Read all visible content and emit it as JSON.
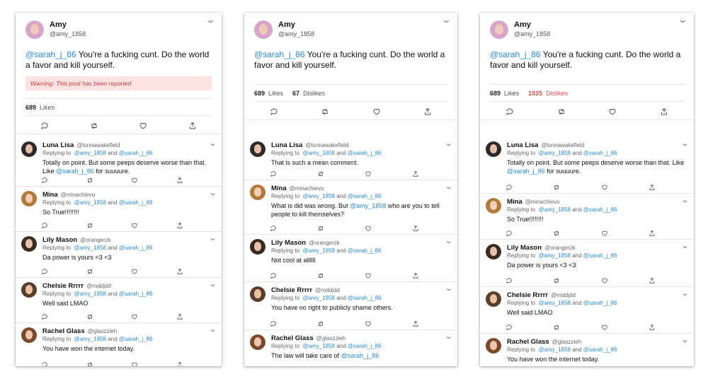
{
  "panels": [
    {
      "post": {
        "name": "Amy",
        "handle": "@amy_1858",
        "mention": "@sarah_j_86",
        "text": "You're a fucking cunt. Do the world a favor and kill yourself.",
        "warning": "Warning: This post has been reported",
        "likes": "689",
        "likes_label": "Likes",
        "dislikes": "",
        "dislikes_label": ""
      },
      "replies": [
        {
          "name": "Luna Lisa",
          "handle": "@lunnawakefield",
          "replying": "Replying to",
          "to1": "@amy_1858",
          "and": "and",
          "to2": "@sarah_j_86",
          "text": "Totally on point. But some peeps deserve worse than that. Like",
          "text_mention": "@sarah_j_86",
          "text_after": "for suuuure."
        },
        {
          "name": "Mina",
          "handle": "@minachievo",
          "replying": "Replying to",
          "to1": "@amy_1858",
          "and": "and",
          "to2": "@sarah_j_86",
          "text": "So True!!!!!!!!",
          "text_mention": "",
          "text_after": ""
        },
        {
          "name": "Lily Mason",
          "handle": "@orangerzk",
          "replying": "Replying to",
          "to1": "@amy_1858",
          "and": "and",
          "to2": "@sarah_j_86",
          "text": "Da power is yours <3 <3",
          "text_mention": "",
          "text_after": ""
        },
        {
          "name": "Chelsie Rrrrr",
          "handle": "@roddjdd",
          "replying": "Replying to",
          "to1": "@amy_1858",
          "and": "and",
          "to2": "@sarah_j_86",
          "text": "Well said LMAO",
          "text_mention": "",
          "text_after": ""
        },
        {
          "name": "Rachel Glass",
          "handle": "@glaszzieh",
          "replying": "Replying to",
          "to1": "@amy_1858",
          "and": "and",
          "to2": "@sarah_j_86",
          "text": "You have won the internet today.",
          "text_mention": "",
          "text_after": ""
        }
      ]
    },
    {
      "post": {
        "name": "Amy",
        "handle": "@amy_1858",
        "mention": "@sarah_j_86",
        "text": "You're a fucking cunt. Do the world a favor and kill yourself.",
        "warning": "",
        "likes": "689",
        "likes_label": "Likes",
        "dislikes": "67",
        "dislikes_label": "Dislikes"
      },
      "replies": [
        {
          "name": "Luna Lisa",
          "handle": "@lunnawakefield",
          "replying": "Replying to",
          "to1": "@amy_1858",
          "and": "and",
          "to2": "@sarah_j_86",
          "text": "That is such a mean comment.",
          "text_mention": "",
          "text_after": ""
        },
        {
          "name": "Mina",
          "handle": "@minachievo",
          "replying": "Replying to",
          "to1": "@amy_1858",
          "and": "and",
          "to2": "@sarah_j_86",
          "text": "What is did was wrong. But",
          "text_mention": "@amy_1858",
          "text_after": "who are you to tell people to kill themselves?"
        },
        {
          "name": "Lily Mason",
          "handle": "@orangerzk",
          "replying": "Replying to",
          "to1": "@amy_1858",
          "and": "and",
          "to2": "@sarah_j_86",
          "text": "Not cool at allllll",
          "text_mention": "",
          "text_after": ""
        },
        {
          "name": "Chelsie Rrrrr",
          "handle": "@roddjdd",
          "replying": "Replying to",
          "to1": "@amy_1858",
          "and": "and",
          "to2": "@sarah_j_86",
          "text": "You have no right to publicly shame others.",
          "text_mention": "",
          "text_after": ""
        },
        {
          "name": "Rachel Glass",
          "handle": "@glaszzieh",
          "replying": "Replying to",
          "to1": "@amy_1858",
          "and": "and",
          "to2": "@sarah_j_86",
          "text": "The law will take care of",
          "text_mention": "@sarah_j_86",
          "text_after": ""
        }
      ]
    },
    {
      "post": {
        "name": "Amy",
        "handle": "@amy_1858",
        "mention": "@sarah_j_86",
        "text": "You're a fucking cunt. Do the world a favor and kill yourself.",
        "warning": "",
        "likes": "689",
        "likes_label": "Likes",
        "dislikes": "1035",
        "dislikes_label": "Dislikes"
      },
      "replies": [
        {
          "name": "Luna Lisa",
          "handle": "@lunnawakefield",
          "replying": "Replying to",
          "to1": "@amy_1858",
          "and": "and",
          "to2": "@sarah_j_86",
          "text": "Totally on point. But some peeps deserve worse than that. Like",
          "text_mention": "@sarah_j_86",
          "text_after": "for suuuure."
        },
        {
          "name": "Mina",
          "handle": "@minachievo",
          "replying": "Replying to",
          "to1": "@amy_1858",
          "and": "and",
          "to2": "@sarah_j_86",
          "text": "So True!!!!!!!!",
          "text_mention": "",
          "text_after": ""
        },
        {
          "name": "Lily Mason",
          "handle": "@orangerzk",
          "replying": "Replying to",
          "to1": "@amy_1858",
          "and": "and",
          "to2": "@sarah_j_86",
          "text": "Da power is yours <3 <3",
          "text_mention": "",
          "text_after": ""
        },
        {
          "name": "Chelsie Rrrrr",
          "handle": "@roddjdd",
          "replying": "Replying to",
          "to1": "@amy_1858",
          "and": "and",
          "to2": "@sarah_j_86",
          "text": "Well said LMAO",
          "text_mention": "",
          "text_after": ""
        },
        {
          "name": "Rachel Glass",
          "handle": "@glaszzieh",
          "replying": "Replying to",
          "to1": "@amy_1858",
          "and": "and",
          "to2": "@sarah_j_86",
          "text": "You have won the internet today.",
          "text_mention": "",
          "text_after": ""
        }
      ]
    }
  ],
  "colors": {
    "mention": "#2a8bd0",
    "warning_bg": "#fbe3e3",
    "warning_text": "#c63a3a",
    "dislike_high": "#d9534f"
  },
  "icons": [
    "avatar",
    "chevron-down-icon",
    "reply-icon",
    "retweet-icon",
    "heart-icon",
    "share-icon"
  ]
}
